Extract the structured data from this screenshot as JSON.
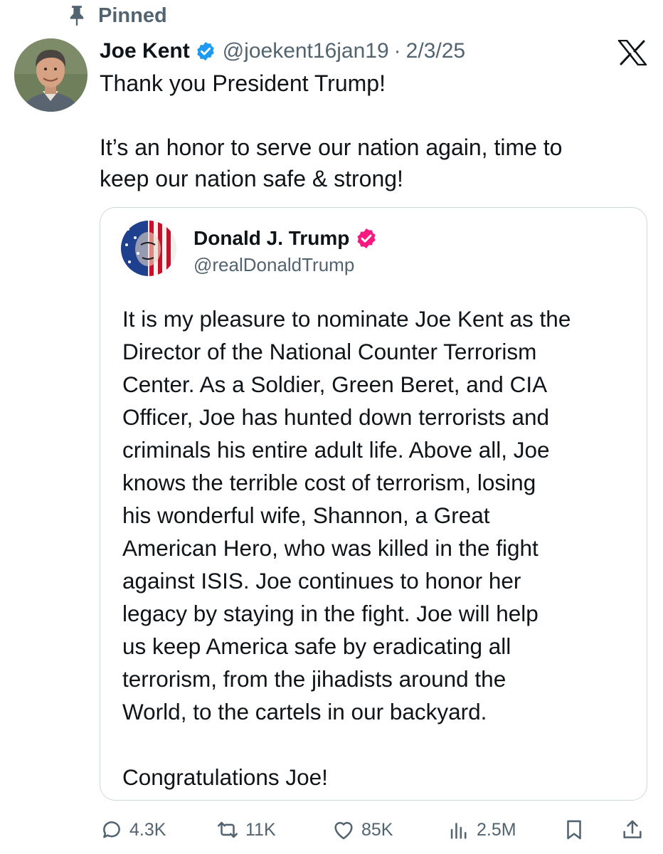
{
  "pinned": {
    "label": "Pinned",
    "icon": "pin-icon"
  },
  "tweet": {
    "author_name": "Joe Kent",
    "handle": "@joekent16jan19",
    "separator": "·",
    "date": "2/3/25",
    "text_lines": [
      "Thank you President Trump!",
      "It’s an honor to serve our nation again, time to",
      "keep our nation safe & strong!"
    ]
  },
  "quoted_tweet": {
    "author_name": "Donald J. Trump",
    "handle": "@realDonaldTrump",
    "text_lines": [
      "It is my pleasure to nominate Joe Kent as the",
      "Director of the National Counter Terrorism",
      "Center. As a Soldier, Green Beret, and CIA",
      "Officer, Joe has hunted down terrorists and",
      "criminals his entire adult life. Above all, Joe",
      "knows the terrible cost of terrorism, losing",
      "his wonderful wife, Shannon, a Great",
      "American Hero, who was killed in the fight",
      "against ISIS. Joe continues to honor her",
      "legacy by staying in the fight. Joe will help",
      "us keep America safe by eradicating all",
      "terrorism, from the jihadists around the",
      "World, to the cartels in our backyard.",
      "Congratulations Joe!"
    ]
  },
  "actions": {
    "replies": "4.3K",
    "reposts": "11K",
    "likes": "85K",
    "views": "2.5M"
  },
  "colors": {
    "text": "#0f1419",
    "secondary": "#536471",
    "verified_blue": "#1d9bf0",
    "verified_pink": "#f91880",
    "border": "#cfd9de"
  }
}
